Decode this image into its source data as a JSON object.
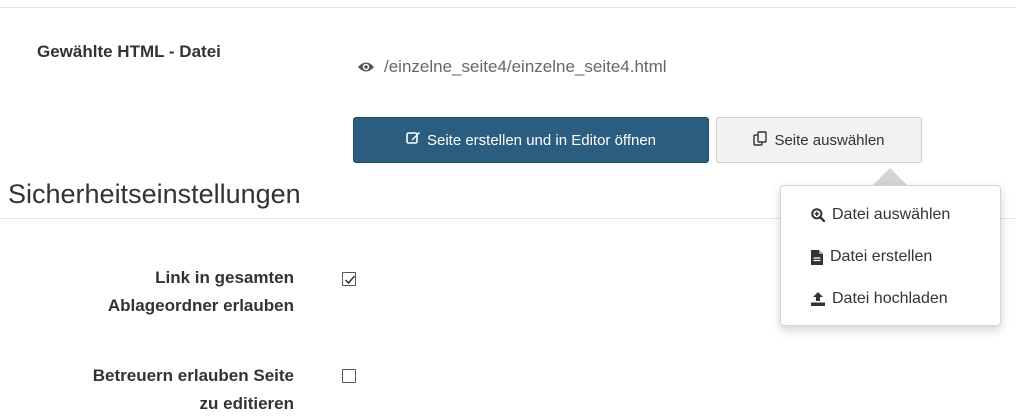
{
  "file_section": {
    "label": "Gewählte HTML - Datei",
    "path": "/einzelne_seite4/einzelne_seite4.html",
    "path_icon": "eye-icon"
  },
  "buttons": {
    "create_open": {
      "label": "Seite erstellen und in Editor öffnen",
      "icon": "edit-icon"
    },
    "select_page": {
      "label": "Seite auswählen",
      "icon": "copy-icon"
    }
  },
  "security": {
    "title": "Sicherheitseinstellungen",
    "rows": [
      {
        "label_line1": "Link in gesamten",
        "label_line2": "Ablageordner erlauben",
        "checked": true
      },
      {
        "label_line1": "Betreuern erlauben Seite",
        "label_line2": "zu editieren",
        "checked": false
      }
    ]
  },
  "dropdown_menu": {
    "items": [
      {
        "label": "Datei auswählen",
        "icon": "zoom-in-icon"
      },
      {
        "label": "Datei erstellen",
        "icon": "file-icon"
      },
      {
        "label": "Datei hochladen",
        "icon": "upload-icon"
      }
    ]
  },
  "colors": {
    "primary_button": "#2b5d80",
    "default_button": "#f2f2f2",
    "text": "#333333",
    "muted_text": "#666666"
  }
}
